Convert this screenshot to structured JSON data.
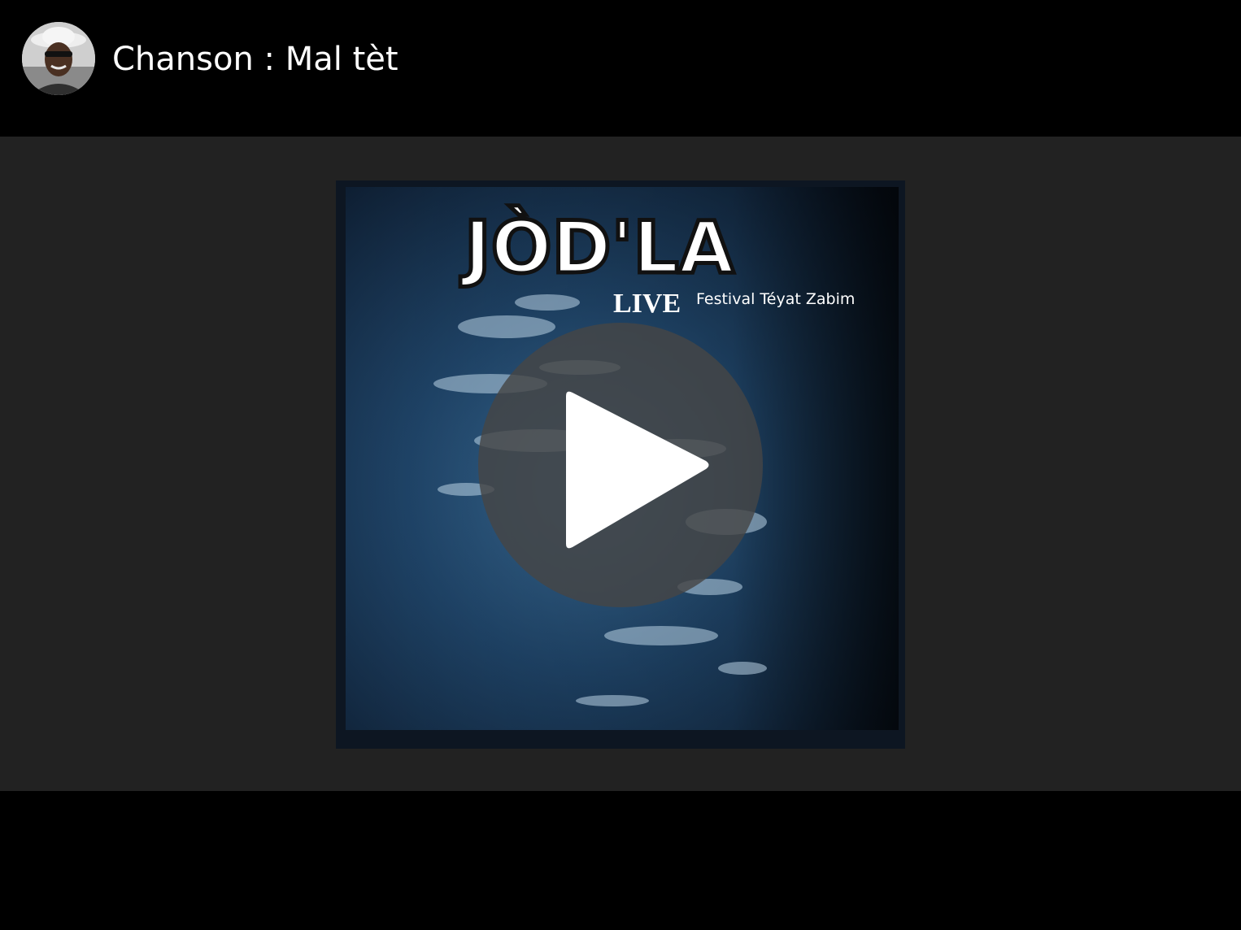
{
  "header": {
    "title": "Chanson : Mal tèt",
    "avatar_alt": "channel avatar"
  },
  "player": {
    "play_icon": "play-icon"
  },
  "cover": {
    "band_name": "JÒD'LA",
    "live_label": "LIVE",
    "subtitle": "Festival Téyat Zabim"
  },
  "colors": {
    "page_background": "#000000",
    "player_background": "#222222",
    "cover_blue": "#1c3a5e",
    "play_overlay": "#464646"
  }
}
